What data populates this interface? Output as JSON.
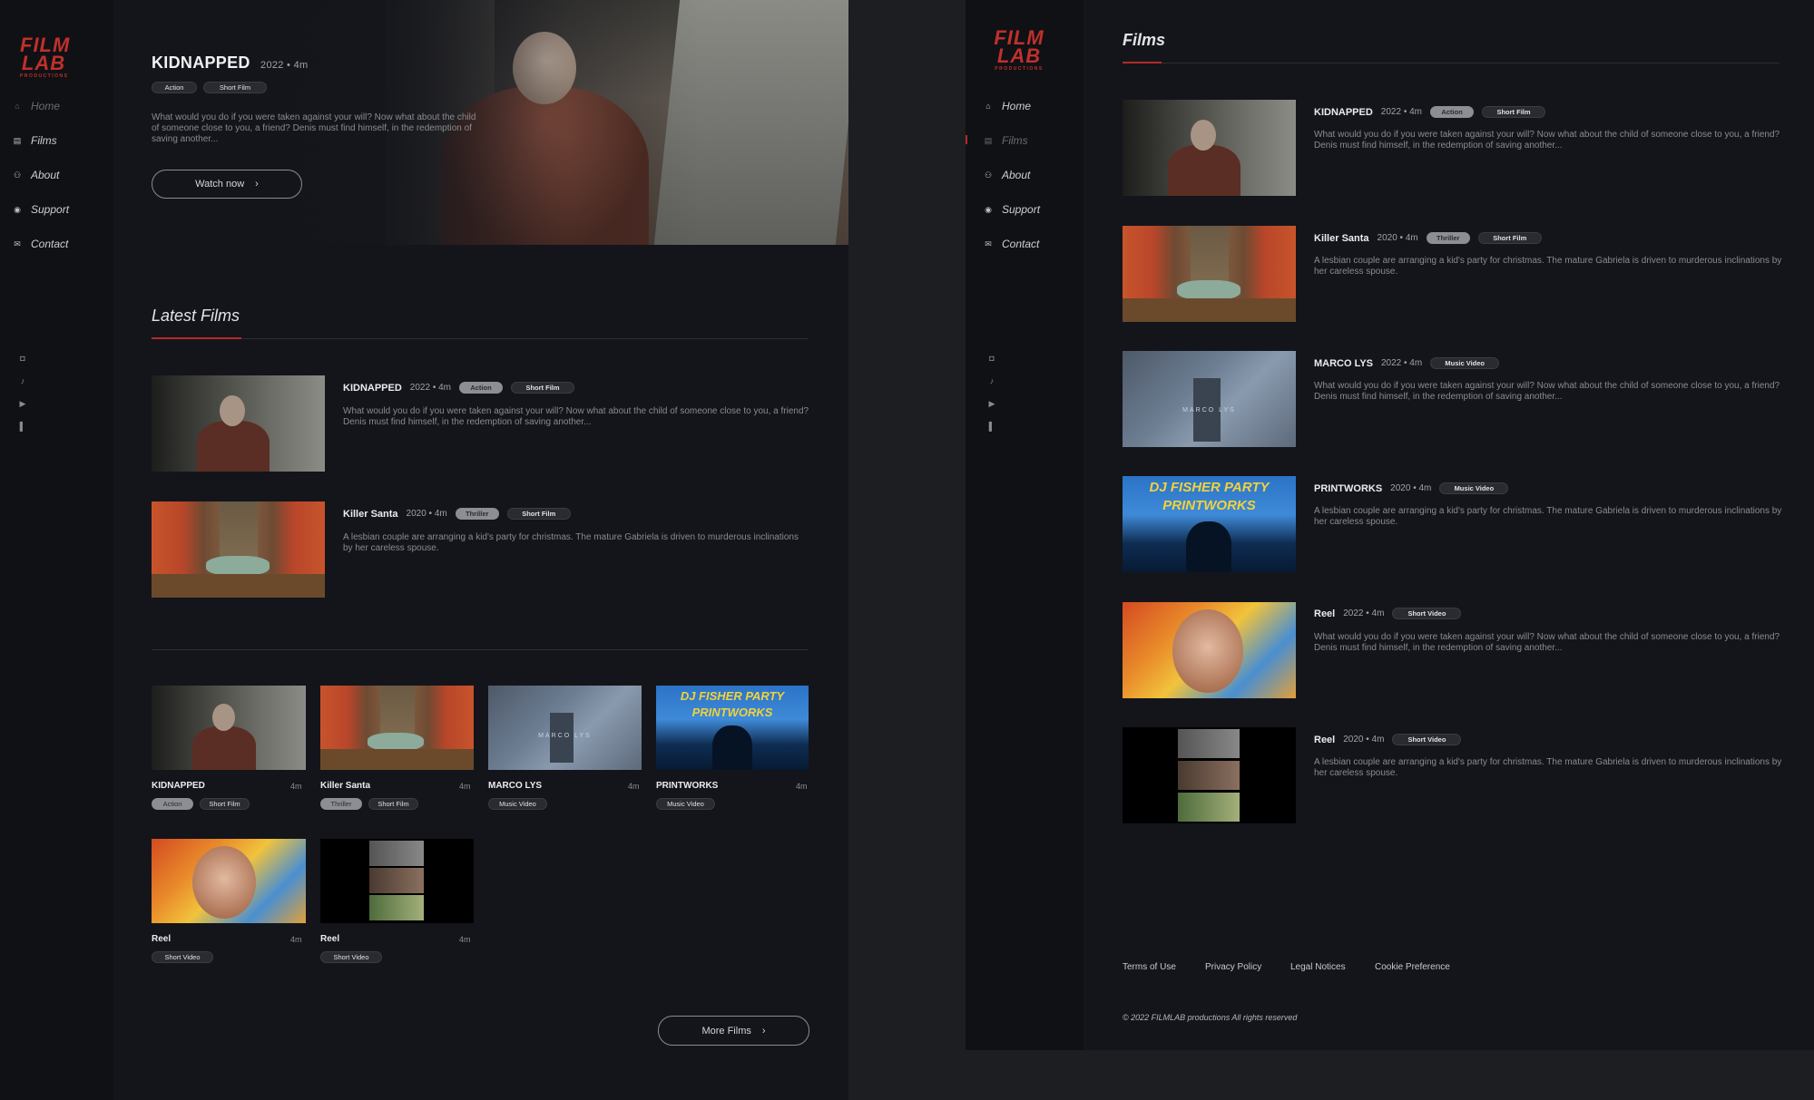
{
  "brand": {
    "line1": "FILM",
    "line2": "LAB",
    "line3": "PRODUCTIONS",
    "color": "#c0302b"
  },
  "nav": [
    {
      "label": "Home",
      "icon": "home-icon"
    },
    {
      "label": "Films",
      "icon": "film-icon"
    },
    {
      "label": "About",
      "icon": "people-icon"
    },
    {
      "label": "Support",
      "icon": "eye-icon"
    },
    {
      "label": "Contact",
      "icon": "mail-icon"
    }
  ],
  "social": [
    "instagram-icon",
    "tiktok-icon",
    "youtube-icon",
    "patreon-icon"
  ],
  "hero": {
    "title": "KIDNAPPED",
    "meta": "2022 • 4m",
    "tags": [
      "Action",
      "Short Film"
    ],
    "description": "What would you do if you were taken against your will? Now what about the child of someone close to you, a friend? Denis must find himself, in the redemption of saving another...",
    "button": "Watch now"
  },
  "latest": {
    "title": "Latest Films",
    "items": [
      {
        "title": "KIDNAPPED",
        "meta": "2022 • 4m",
        "tags": [
          "Action",
          "Short Film"
        ],
        "description": "What would you do if you were taken against your will? Now what about the child of someone close to you, a friend? Denis must find himself, in the redemption of saving another..."
      },
      {
        "title": "Killer Santa",
        "meta": "2020 • 4m",
        "tags": [
          "Thriller",
          "Short Film"
        ],
        "description": "A lesbian couple are arranging a kid's party for christmas. The mature Gabriela is driven to murderous inclinations by her careless spouse."
      }
    ]
  },
  "grid": [
    {
      "title": "KIDNAPPED",
      "duration": "4m",
      "tags": [
        "Action",
        "Short Film"
      ]
    },
    {
      "title": "Killer Santa",
      "duration": "4m",
      "tags": [
        "Thriller",
        "Short Film"
      ]
    },
    {
      "title": "MARCO LYS",
      "duration": "4m",
      "tags": [
        "Music Video"
      ]
    },
    {
      "title": "PRINTWORKS",
      "duration": "4m",
      "tags": [
        "Music Video"
      ]
    },
    {
      "title": "Reel",
      "duration": "4m",
      "tags": [
        "Short Video"
      ]
    },
    {
      "title": "Reel",
      "duration": "4m",
      "tags": [
        "Short Video"
      ]
    }
  ],
  "more_button": "More Films",
  "thumb_text": {
    "dj1": "DJ FISHER PARTY",
    "dj2": "PRINTWORKS",
    "marco": "MARCO LYS"
  },
  "films_page": {
    "title": "Films",
    "items": [
      {
        "title": "KIDNAPPED",
        "meta": "2022 • 4m",
        "tags": [
          "Action",
          "Short Film"
        ],
        "description": "What would you do if you were taken against your will? Now what about the child of someone close to you, a friend? Denis must find himself, in the redemption of saving another..."
      },
      {
        "title": "Killer Santa",
        "meta": "2020 • 4m",
        "tags": [
          "Thriller",
          "Short Film"
        ],
        "description": "A lesbian couple are arranging a kid's party for christmas. The mature Gabriela is driven to murderous inclinations by her careless spouse."
      },
      {
        "title": "MARCO LYS",
        "meta": "2022 • 4m",
        "tags": [
          "Music Video"
        ],
        "description": "What would you do if you were taken against your will? Now what about the child of someone close to you, a friend? Denis must find himself, in the redemption of saving another..."
      },
      {
        "title": "PRINTWORKS",
        "meta": "2020 • 4m",
        "tags": [
          "Music Video"
        ],
        "description": "A lesbian couple are arranging a kid's party for christmas. The mature Gabriela is driven to murderous inclinations by her careless spouse."
      },
      {
        "title": "Reel",
        "meta": "2022 • 4m",
        "tags": [
          "Short Video"
        ],
        "description": "What would you do if you were taken against your will? Now what about the child of someone close to you, a friend? Denis must find himself, in the redemption of saving another..."
      },
      {
        "title": "Reel",
        "meta": "2020 • 4m",
        "tags": [
          "Short Video"
        ],
        "description": "A lesbian couple are arranging a kid's party for christmas. The mature Gabriela is driven to murderous inclinations by her careless spouse."
      }
    ]
  },
  "footer": {
    "links": [
      "Terms of Use",
      "Privacy Policy",
      "Legal Notices",
      "Cookie Preference"
    ],
    "copyright": "© 2022 FILMLAB productions All rights reserved"
  }
}
